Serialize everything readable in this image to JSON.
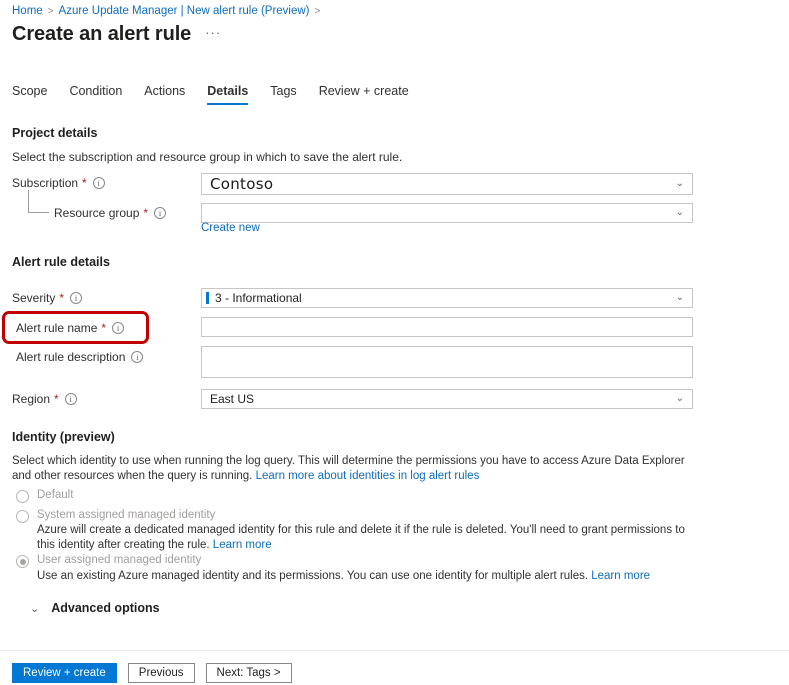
{
  "breadcrumb": {
    "home": "Home",
    "sep": ">",
    "parent": "Azure Update Manager | New alert rule (Preview)",
    "trailing_sep": ">"
  },
  "header": {
    "title": "Create an alert rule",
    "more_actions": "···"
  },
  "tabs": [
    {
      "label": "Scope",
      "active": false
    },
    {
      "label": "Condition",
      "active": false
    },
    {
      "label": "Actions",
      "active": false
    },
    {
      "label": "Details",
      "active": true
    },
    {
      "label": "Tags",
      "active": false
    },
    {
      "label": "Review + create",
      "active": false
    }
  ],
  "project_details": {
    "heading": "Project details",
    "description": "Select the subscription and resource group in which to save the alert rule.",
    "subscription": {
      "label": "Subscription",
      "required": "*",
      "value": "Contoso",
      "chevron": "⌄"
    },
    "resource_group": {
      "label": "Resource group",
      "required": "*",
      "value": "",
      "chevron": "⌄",
      "create_new": "Create new"
    }
  },
  "alert_rule_details": {
    "heading": "Alert rule details",
    "severity": {
      "label": "Severity",
      "required": "*",
      "value": "3 - Informational",
      "chevron": "⌄",
      "indicator_color": "#0078d4"
    },
    "name": {
      "label": "Alert rule name",
      "required": "*",
      "value": "",
      "highlighted": true,
      "highlight_color": "#c00000"
    },
    "description": {
      "label": "Alert rule description",
      "required": "",
      "value": ""
    },
    "region": {
      "label": "Region",
      "required": "*",
      "value": "East US",
      "chevron": "⌄"
    }
  },
  "identity": {
    "heading": "Identity (preview)",
    "description": "Select which identity to use when running the log query. This will determine the permissions you have to access Azure Data Explorer and other resources when the query is running.",
    "description_link": "Learn more about identities in log alert rules",
    "options": [
      {
        "label": "Default",
        "selected": false,
        "help": "",
        "help_link": ""
      },
      {
        "label": "System assigned managed identity",
        "selected": false,
        "help": "Azure will create a dedicated managed identity for this rule and delete it if the rule is deleted. You'll need to grant permissions to this identity after creating the rule.",
        "help_link": "Learn more"
      },
      {
        "label": "User assigned managed identity",
        "selected": true,
        "help": "Use an existing Azure managed identity and its permissions. You can use one identity for multiple alert rules.",
        "help_link": "Learn more"
      }
    ]
  },
  "advanced": {
    "label": "Advanced options",
    "chevron": "⌄"
  },
  "footer": {
    "review_create": "Review + create",
    "previous": "Previous",
    "next": "Next: Tags >"
  },
  "colors": {
    "accent": "#0078d4",
    "link": "#0f6cbd",
    "required": "#a4262c",
    "annotation": "#c00000"
  }
}
